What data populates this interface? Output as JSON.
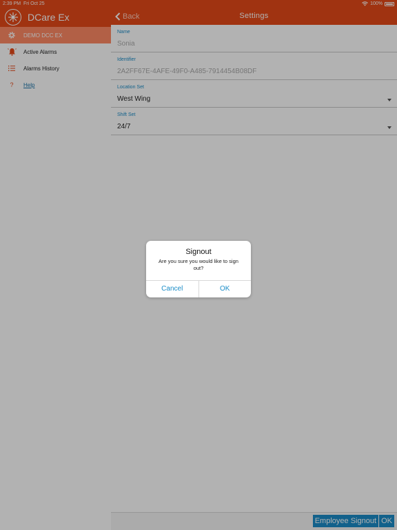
{
  "status_bar": {
    "time": "2:39 PM",
    "date": "Fri Oct 25",
    "battery": "100%"
  },
  "sidebar": {
    "app_title": "DCare Ex",
    "items": [
      {
        "label": "DEMO DCC EX",
        "icon": "gear-icon",
        "active": true
      },
      {
        "label": "Active Alarms",
        "icon": "bell-alarm-icon"
      },
      {
        "label": "Alarms History",
        "icon": "list-icon"
      },
      {
        "label": "Help",
        "icon": "question-icon"
      }
    ]
  },
  "header": {
    "back_label": "Back",
    "title": "Settings"
  },
  "fields": {
    "name": {
      "label": "Name",
      "value": "Sonia"
    },
    "identifier": {
      "label": "Identifier",
      "value": "2A2FF67E-4AFE-49F0-A485-7914454B08DF"
    },
    "location_set": {
      "label": "Location Set",
      "value": "West Wing"
    },
    "shift_set": {
      "label": "Shift Set",
      "value": "24/7"
    }
  },
  "footer": {
    "employee_signout": "Employee Signout",
    "ok": "OK"
  },
  "dialog": {
    "title": "Signout",
    "message": "Are you sure you would like to sign out?",
    "cancel": "Cancel",
    "ok": "OK"
  },
  "colors": {
    "accent": "#e64a19",
    "active_item": "#ff8a65",
    "link_blue": "#1a8cc7"
  }
}
